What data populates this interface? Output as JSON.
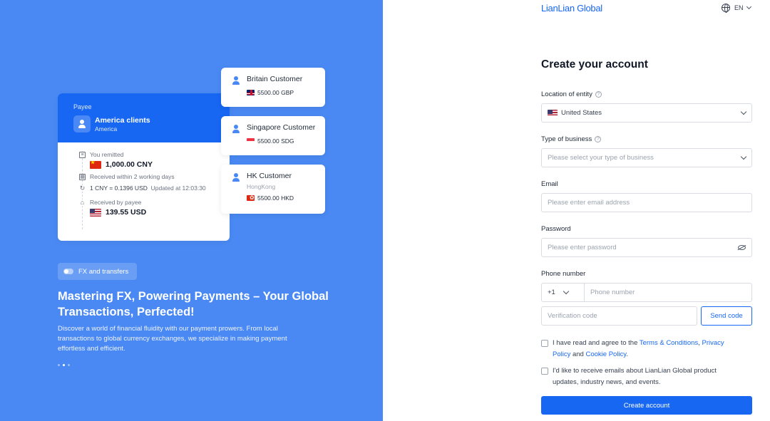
{
  "promo": {
    "payee_card": {
      "header_label": "Payee",
      "client_name": "America clients",
      "client_region": "America",
      "steps": [
        {
          "label": "You remitted",
          "amount": "1,000.00 CNY",
          "flag": "cn"
        },
        {
          "label": "Received within 2 working days"
        },
        {
          "label": "1 CNY = 0.1396 USD",
          "note": "Updated at 12:03:30"
        },
        {
          "label": "Received by payee",
          "amount": "139.55 USD",
          "flag": "us"
        }
      ]
    },
    "customers": [
      {
        "name": "Britain Customer",
        "city": "",
        "amount": "5500.00 GBP",
        "flag": "gb"
      },
      {
        "name": "Singapore Customer",
        "city": "",
        "amount": "5500.00 SDG",
        "flag": "sg"
      },
      {
        "name": "HK Customer",
        "city": "HongKong",
        "amount": "5500.00 HKD",
        "flag": "hk"
      }
    ],
    "chip_label": "FX and transfers",
    "headline": "Mastering FX, Powering Payments – Your Global Transactions, Perfected!",
    "description": "Discover a world of financial fluidity with our payment prowers. From local transactions to global currency exchanges, we specialize in making payment effortless and efficient.",
    "carousel": {
      "total": 3,
      "active": 2
    },
    "colors": {
      "panel_bg": "#4a89f3",
      "card_header": "#1767f2"
    }
  },
  "header": {
    "logo": "LianLian Global",
    "language": "EN",
    "icons": [
      "globe-icon",
      "chevron-down-icon"
    ]
  },
  "form": {
    "title": "Create your account",
    "location": {
      "label": "Location of entity",
      "value": "United States",
      "flag": "us"
    },
    "business": {
      "label": "Type of business",
      "placeholder": "Please select your type of business"
    },
    "email": {
      "label": "Email",
      "placeholder": "Please enter email address"
    },
    "password": {
      "label": "Password",
      "placeholder": "Please enter password"
    },
    "phone": {
      "label": "Phone number",
      "country_code": "+1",
      "placeholder": "Phone number",
      "verification_placeholder": "Verification code",
      "send_code": "Send code"
    },
    "terms": {
      "prefix": "I have read and agree to the ",
      "terms_link": "Terms & Conditions",
      "sep": ", ",
      "privacy_link": "Privacy Policy",
      "and": " and ",
      "cookie_link": "Cookie Policy",
      "suffix": "."
    },
    "marketing": "I'd like to receive emails about LianLian Global product updates, industry news, and events.",
    "submit": "Create account",
    "accent": "#1767f2"
  }
}
